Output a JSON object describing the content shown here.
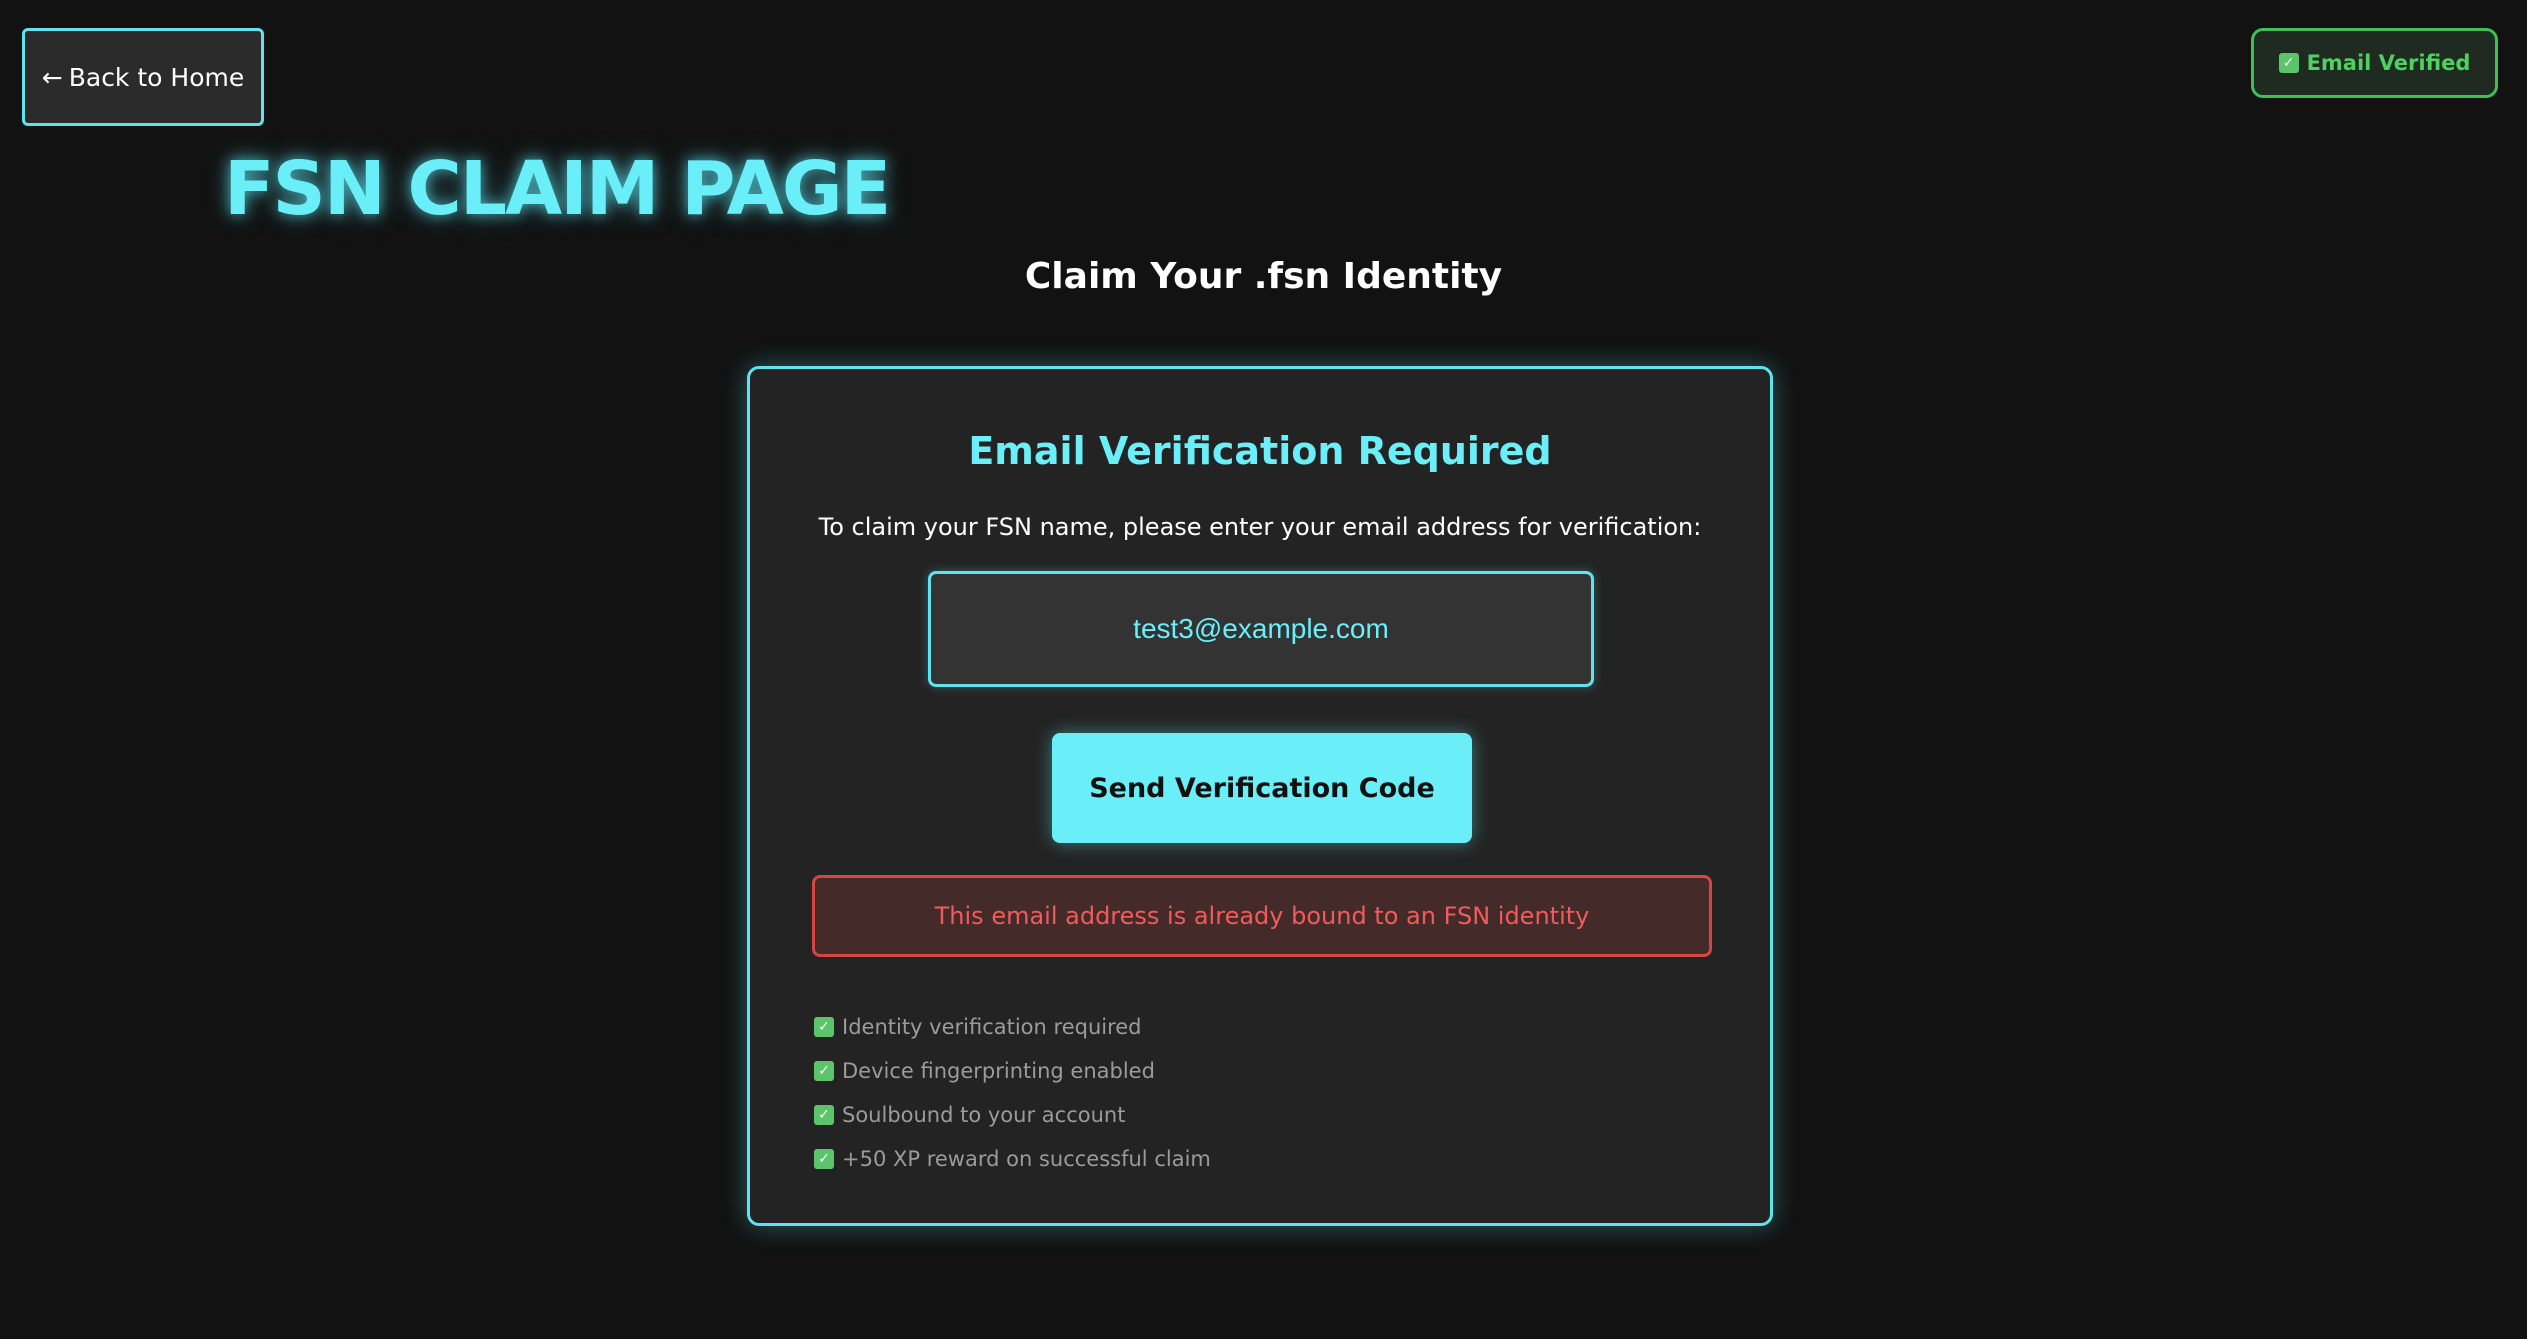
{
  "nav": {
    "back_arrow": "←",
    "back_label": "Back to Home"
  },
  "status_badge": {
    "icon": "check-box-icon",
    "check": "✓",
    "label": "Email Verified"
  },
  "header": {
    "title": "FSN CLAIM PAGE",
    "subtitle": "Claim Your .fsn Identity"
  },
  "verification": {
    "heading": "Email Verification Required",
    "instructions": "To claim your FSN name, please enter your email address for verification:",
    "email_value": "test3@example.com",
    "send_label": "Send Verification Code",
    "error_message": "This email address is already bound to an FSN identity"
  },
  "features": {
    "check": "✓",
    "items": [
      "Identity verification required",
      "Device fingerprinting enabled",
      "Soulbound to your account",
      "+50 XP reward on successful claim"
    ]
  },
  "colors": {
    "accent": "#6aeef8",
    "success": "#4fd062",
    "error": "#ef5c5c",
    "background": "#121212",
    "card": "#232323"
  }
}
